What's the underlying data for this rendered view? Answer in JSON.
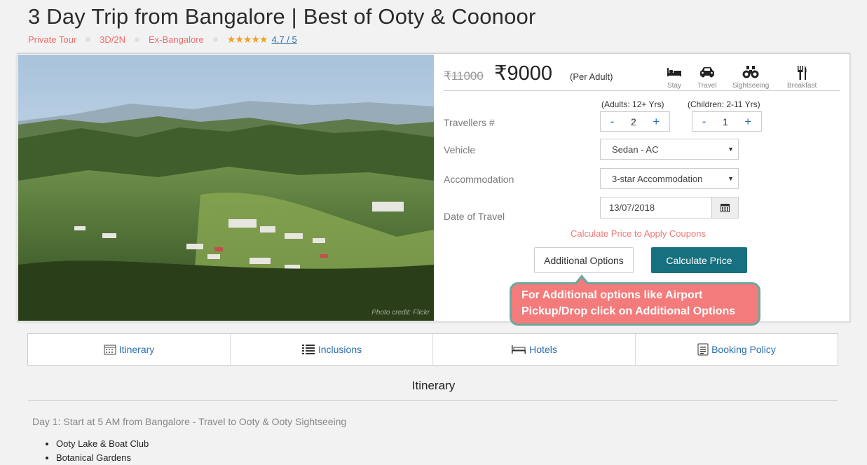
{
  "header": {
    "title": "3 Day Trip from Bangalore | Best of Ooty & Coonoor",
    "tags": [
      "Private Tour",
      "3D/2N",
      "Ex-Bangalore"
    ],
    "stars": "★★★★★",
    "rating": "4.7 / 5"
  },
  "photo": {
    "credit": "Photo credit: Flickr"
  },
  "pricing": {
    "old_price": "11000",
    "new_price": "9000",
    "per_adult": "(Per Adult)",
    "amenities": [
      {
        "label": "Stay",
        "icon": "bed-icon"
      },
      {
        "label": "Travel",
        "icon": "car-icon"
      },
      {
        "label": "Sightseeing",
        "icon": "binoculars-icon"
      },
      {
        "label": "Breakfast",
        "icon": "cutlery-icon"
      }
    ]
  },
  "form": {
    "travellers_label": "Travellers #",
    "adults_label": "(Adults: 12+ Yrs)",
    "children_label": "(Children: 2-11 Yrs)",
    "adults_value": "2",
    "children_value": "1",
    "minus": "-",
    "plus": "+",
    "vehicle_label": "Vehicle",
    "vehicle_value": "Sedan - AC",
    "accommodation_label": "Accommodation",
    "accommodation_value": "3-star Accommodation",
    "date_label": "Date of Travel",
    "date_value": "13/07/2018",
    "coupon_hint": "Calculate Price to Apply Coupons",
    "additional_button": "Additional Options",
    "calculate_button": "Calculate Price"
  },
  "callout": "For Additional options like Airport Pickup/Drop click on Additional Options",
  "tabs": [
    "Itinerary",
    "Inclusions",
    "Hotels",
    "Booking Policy"
  ],
  "itinerary": {
    "title": "Itinerary",
    "day1": "Day 1: Start at 5 AM from Bangalore - Travel to Ooty & Ooty Sightseeing",
    "items": [
      "Ooty Lake & Boat Club",
      "Botanical Gardens"
    ]
  },
  "colors": {
    "accent": "#17707f",
    "tag": "#f06b6b",
    "link": "#2a6fb0",
    "callout": "#f47b7b"
  }
}
